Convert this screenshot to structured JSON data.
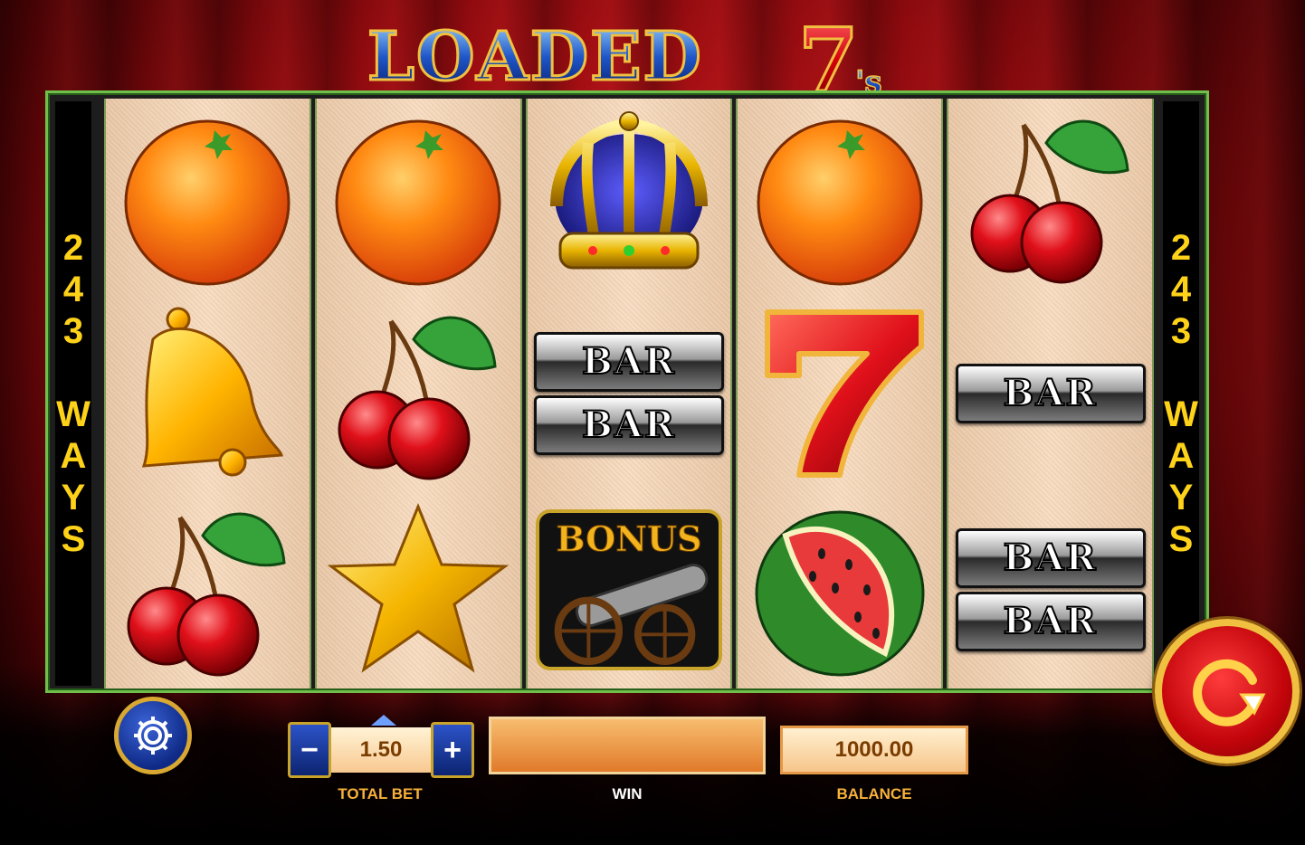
{
  "game": {
    "title_word": "LOADED",
    "title_number": "7",
    "title_suffix": "'s"
  },
  "reels": {
    "ways_left": "243 WAYS",
    "ways_right": "243 WAYS",
    "columns": [
      [
        "orange",
        "bell",
        "cherry"
      ],
      [
        "orange",
        "cherry",
        "star"
      ],
      [
        "crown",
        "double-bar",
        "bonus"
      ],
      [
        "orange",
        "seven",
        "watermelon"
      ],
      [
        "cherry",
        "bar",
        "double-bar"
      ]
    ],
    "bar_text": "BAR",
    "bonus_text": "BONUS"
  },
  "controls": {
    "total_bet_value": "1.50",
    "total_bet_label": "TOTAL BET",
    "win_label": "WIN",
    "win_value": "",
    "balance_value": "1000.00",
    "balance_label": "BALANCE",
    "minus_label": "−",
    "plus_label": "+"
  },
  "colors": {
    "frame_border": "#6fbf4a",
    "ways_text": "#ffd21a",
    "label_text": "#f6b13a",
    "spin_red": "#c3050b",
    "gold": "#f0c040"
  }
}
